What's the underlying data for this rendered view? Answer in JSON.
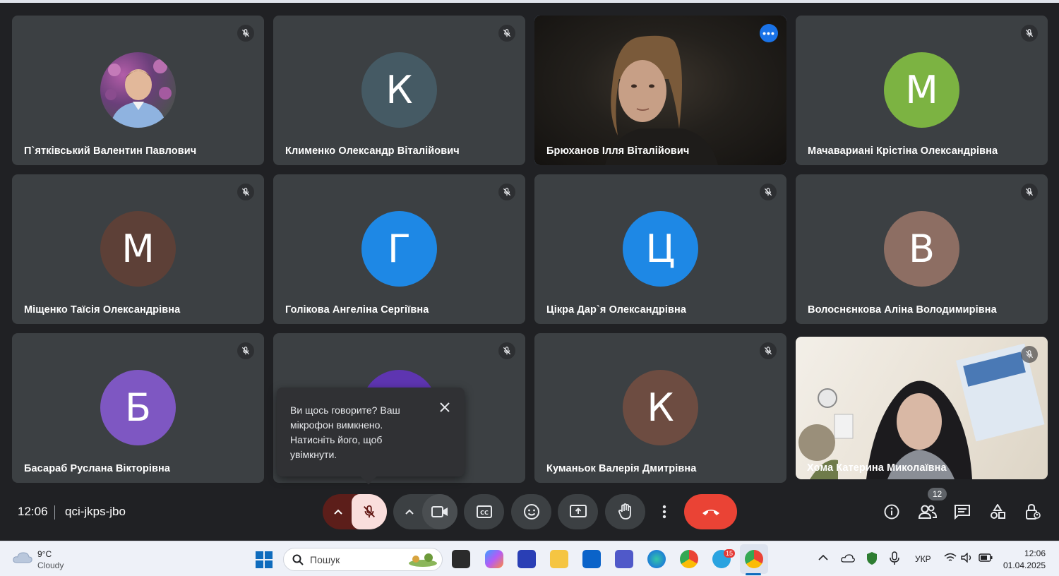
{
  "participants": [
    {
      "name": "П`ятківський Валентин Павлович",
      "initial": "",
      "avatar_color": "#6a4a7a",
      "type": "photo"
    },
    {
      "name": "Клименко Олександр Віталійович",
      "initial": "К",
      "avatar_color": "#455a64"
    },
    {
      "name": "Брюханов Ілля Віталійович",
      "initial": "",
      "avatar_color": "",
      "type": "video"
    },
    {
      "name": "Мачавариані Крістіна Олександрівна",
      "initial": "М",
      "avatar_color": "#7cb342"
    },
    {
      "name": "Міщенко Таїсія Олександрівна",
      "initial": "М",
      "avatar_color": "#5d4037"
    },
    {
      "name": "Голікова Ангеліна Сергіївна",
      "initial": "Г",
      "avatar_color": "#1e88e5"
    },
    {
      "name": "Цікра Дар`я Олександрівна",
      "initial": "Ц",
      "avatar_color": "#1e88e5"
    },
    {
      "name": "Волоснєнкова Аліна Володимирівна",
      "initial": "В",
      "avatar_color": "#8d6e63"
    },
    {
      "name": "Басараб Руслана Вікторівна",
      "initial": "Б",
      "avatar_color": "#7e57c2"
    },
    {
      "name": "",
      "initial": "",
      "avatar_color": "#5e35b1"
    },
    {
      "name": "Куманьок Валерія Дмитрівна",
      "initial": "К",
      "avatar_color": "#6d4c41"
    },
    {
      "name": "Хома Катерина Миколаївна",
      "initial": "",
      "avatar_color": "",
      "type": "video"
    }
  ],
  "popover": {
    "message": "Ви щось говорите? Ваш мікрофон вимкнено. Натисніть його, щоб увімкнути."
  },
  "meeting": {
    "time": "12:06",
    "code": "qci-jkps-jbo",
    "people_count": "12"
  },
  "colors": {
    "leave": "#ea4335",
    "mic_off_bg": "#f9dedc",
    "accent": "#8ab4f8"
  },
  "taskbar": {
    "weather_temp": "9°C",
    "weather_condition": "Cloudy",
    "search_placeholder": "Пошук",
    "telegram_badge": "15",
    "language": "УКР",
    "clock_time": "12:06",
    "clock_date": "01.04.2025"
  }
}
